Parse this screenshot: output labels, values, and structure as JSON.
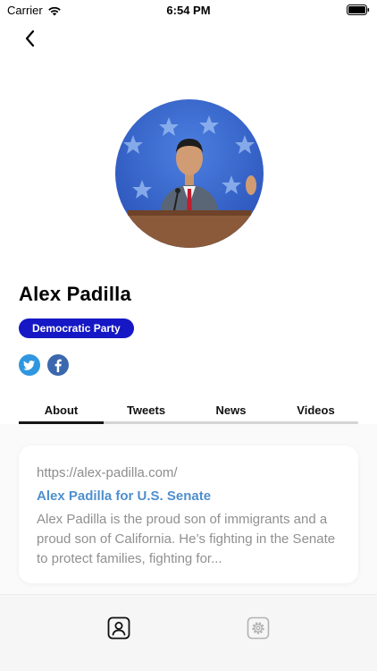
{
  "status_bar": {
    "carrier": "Carrier",
    "time": "6:54 PM"
  },
  "profile": {
    "name": "Alex Padilla",
    "party": "Democratic Party",
    "party_color": "#1518c4"
  },
  "social": {
    "twitter_icon": "twitter-icon",
    "facebook_icon": "facebook-icon"
  },
  "tabs": [
    {
      "label": "About",
      "active": true
    },
    {
      "label": "Tweets",
      "active": false
    },
    {
      "label": "News",
      "active": false
    },
    {
      "label": "Videos",
      "active": false
    }
  ],
  "about_card": {
    "url": "https://alex-padilla.com/",
    "title": "Alex Padilla for U.S. Senate",
    "description": "Alex Padilla is the proud son of immigrants and a proud son of California. He’s fighting in the Senate to protect families, fighting for..."
  },
  "colors": {
    "link": "#4f8fcd",
    "twitter": "#2f97e0",
    "facebook": "#3b68ad"
  },
  "bottom_nav": {
    "profile_icon": "person-icon",
    "settings_icon": "gear-icon"
  }
}
